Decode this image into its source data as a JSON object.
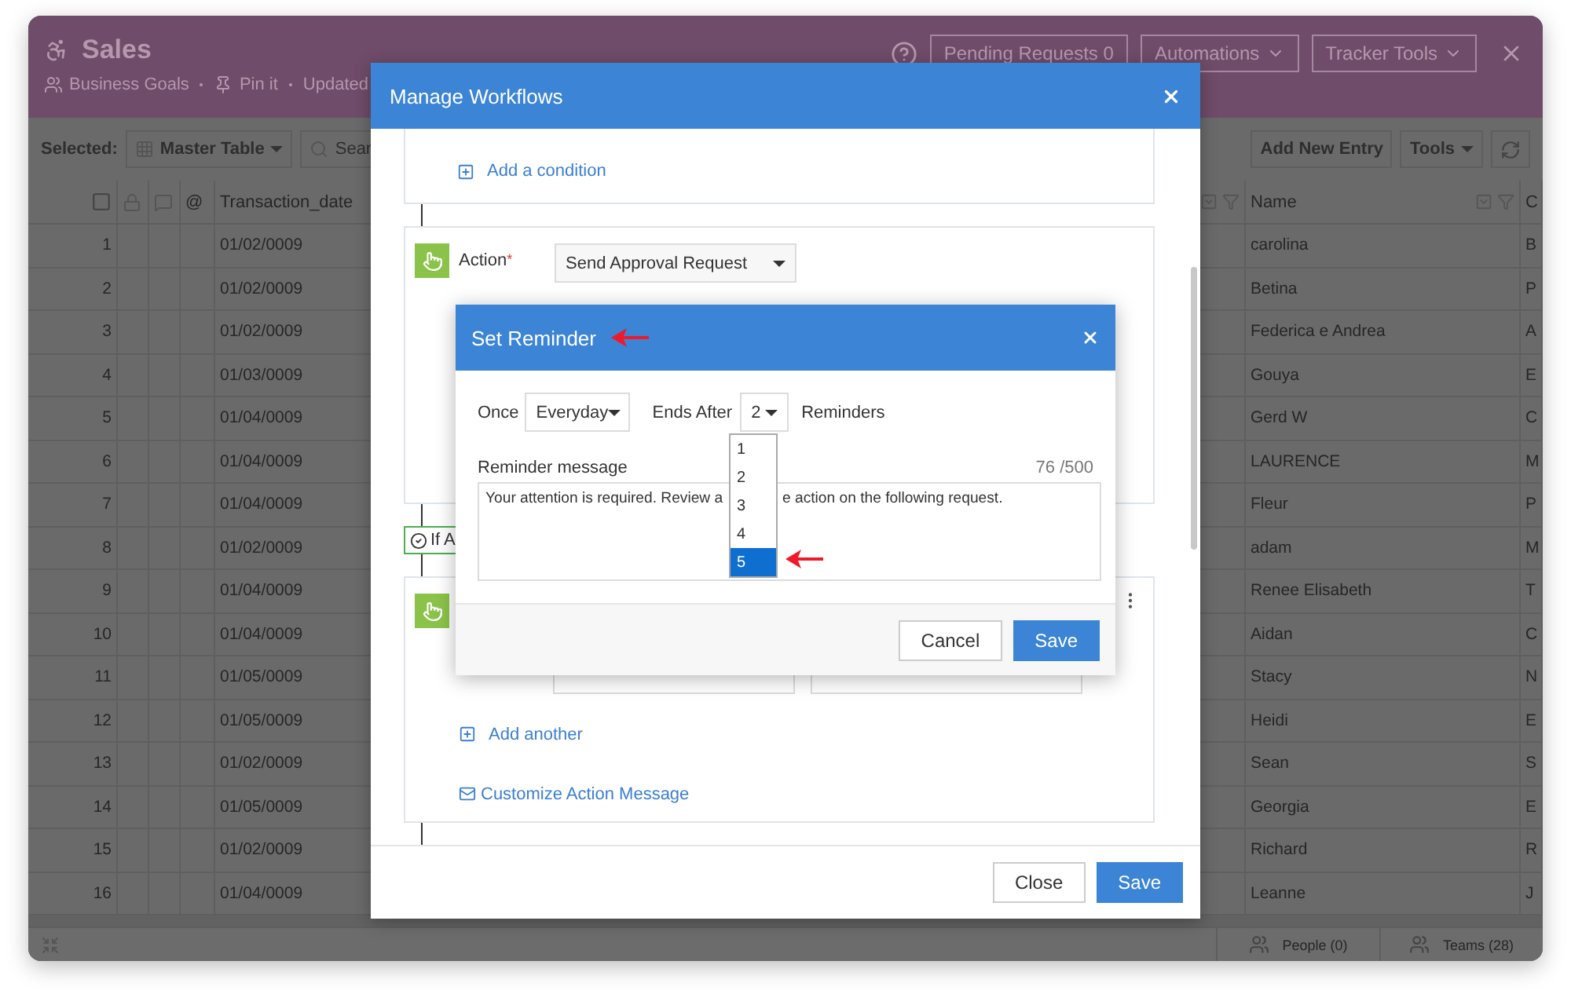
{
  "app": {
    "title": "Sales",
    "meta": [
      "Business Goals",
      "Pin it",
      "Updated"
    ],
    "header_buttons": [
      {
        "label": "Pending Requests 0",
        "dropdown": false
      },
      {
        "label": "Automations",
        "dropdown": true
      },
      {
        "label": "Tracker Tools",
        "dropdown": true
      }
    ]
  },
  "toolbar": {
    "selected_label": "Selected:",
    "view": "Master Table",
    "search_placeholder": "Sear",
    "add_button": "Add New Entry",
    "tools_button": "Tools"
  },
  "table": {
    "select_all_checked": false,
    "columns": [
      "@",
      "Transaction_date",
      "Name",
      "C"
    ],
    "rows": [
      {
        "number": "1",
        "transaction_date": "01/02/0009",
        "name": "carolina",
        "column_3": "B"
      },
      {
        "number": "2",
        "transaction_date": "01/02/0009",
        "name": "Betina",
        "column_3": "P"
      },
      {
        "number": "3",
        "transaction_date": "01/02/0009",
        "name": "Federica e Andrea",
        "column_3": "A"
      },
      {
        "number": "4",
        "transaction_date": "01/03/0009",
        "name": "Gouya",
        "column_3": "E"
      },
      {
        "number": "5",
        "transaction_date": "01/04/0009",
        "name": "Gerd W",
        "column_3": "C"
      },
      {
        "number": "6",
        "transaction_date": "01/04/0009",
        "name": "LAURENCE",
        "column_3": "M"
      },
      {
        "number": "7",
        "transaction_date": "01/04/0009",
        "name": "Fleur",
        "column_3": "P"
      },
      {
        "number": "8",
        "transaction_date": "01/02/0009",
        "name": "adam",
        "column_3": "M"
      },
      {
        "number": "9",
        "transaction_date": "01/04/0009",
        "name": "Renee Elisabeth",
        "column_3": "T"
      },
      {
        "number": "10",
        "transaction_date": "01/04/0009",
        "name": "Aidan",
        "column_3": "C"
      },
      {
        "number": "11",
        "transaction_date": "01/05/0009",
        "name": "Stacy",
        "column_3": "N"
      },
      {
        "number": "12",
        "transaction_date": "01/05/0009",
        "name": "Heidi",
        "column_3": "E"
      },
      {
        "number": "13",
        "transaction_date": "01/02/0009",
        "name": "Sean",
        "column_3": "S"
      },
      {
        "number": "14",
        "transaction_date": "01/05/0009",
        "name": "Georgia",
        "column_3": "E"
      },
      {
        "number": "15",
        "transaction_date": "01/02/0009",
        "name": "Richard",
        "column_3": "R"
      },
      {
        "number": "16",
        "transaction_date": "01/04/0009",
        "name": "Leanne",
        "column_3": "J"
      }
    ]
  },
  "footer": {
    "tabs": [
      "People (0)",
      "Teams (28)"
    ]
  },
  "workflow_modal": {
    "title": "Manage Workflows",
    "add_condition": "Add a condition",
    "action": {
      "label": "Action",
      "required_mark": "*",
      "value": "Send Approval Request"
    },
    "branch_label": "If A",
    "add_another": "Add another",
    "customize_message": "Customize Action Message",
    "close_button": "Close",
    "save_button": "Save"
  },
  "reminder": {
    "title": "Set Reminder",
    "once_label": "Once",
    "frequency": "Everyday",
    "ends_after_label": "Ends After",
    "ends_after": "2",
    "count_options": [
      {
        "label": "1",
        "selected": false
      },
      {
        "label": "2",
        "selected": false
      },
      {
        "label": "3",
        "selected": false
      },
      {
        "label": "4",
        "selected": false
      },
      {
        "label": "5",
        "selected": true
      }
    ],
    "reminders_label": "Reminders",
    "message_label": "Reminder message",
    "char_count": "76 /500",
    "message_parts": [
      "Your attention is required. Review a",
      "e action on the following request."
    ],
    "cancel_button": "Cancel",
    "save_button": "Save"
  }
}
